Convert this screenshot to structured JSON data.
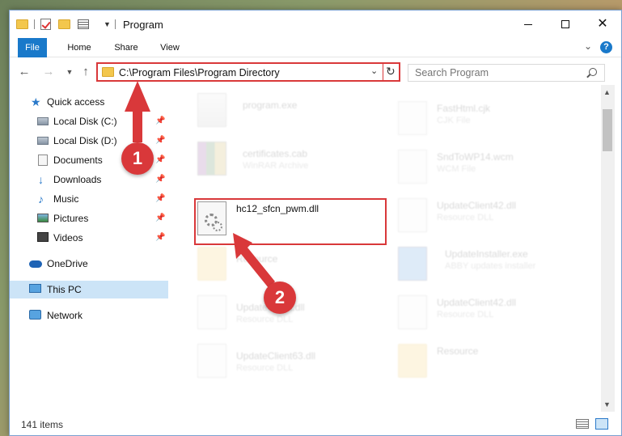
{
  "window": {
    "title": "Program",
    "quick_access_toolbar": [
      "folder-icon",
      "properties-check-icon",
      "new-folder-icon",
      "properties-icon"
    ],
    "controls": {
      "minimize": "minimize-icon",
      "maximize": "maximize-icon",
      "close": "✕"
    }
  },
  "ribbon": {
    "tabs": [
      {
        "label": "File"
      },
      {
        "label": "Home"
      },
      {
        "label": "Share"
      },
      {
        "label": "View"
      }
    ],
    "help": "?"
  },
  "navigation": {
    "address": "C:\\Program Files\\Program Directory",
    "search_placeholder": "Search Program"
  },
  "sidebar": {
    "quick_access": "Quick access",
    "items": [
      {
        "label": "Local Disk (C:)",
        "icon": "disk-icon",
        "pinned": true
      },
      {
        "label": "Local Disk (D:)",
        "icon": "disk-icon",
        "pinned": true
      },
      {
        "label": "Documents",
        "icon": "documents-icon",
        "pinned": true
      },
      {
        "label": "Downloads",
        "icon": "downloads-icon",
        "pinned": true
      },
      {
        "label": "Music",
        "icon": "music-icon",
        "pinned": true
      },
      {
        "label": "Pictures",
        "icon": "pictures-icon",
        "pinned": true
      },
      {
        "label": "Videos",
        "icon": "videos-icon",
        "pinned": true
      }
    ],
    "onedrive": "OneDrive",
    "this_pc": "This PC",
    "network": "Network"
  },
  "files": {
    "left": [
      {
        "name": "program.exe",
        "type": "",
        "icon": "exe-icon"
      },
      {
        "name": "certificates.cab",
        "type": "WinRAR Archive",
        "icon": "winrar-icon"
      },
      {
        "name": "hc12_sfcn_pwm.dll",
        "type": "",
        "icon": "dll-icon"
      },
      {
        "name": "Resource",
        "type": "",
        "icon": "folder-icon"
      },
      {
        "name": "UpdateClient.dll",
        "type": "Resource DLL",
        "icon": "dll-icon"
      },
      {
        "name": "UpdateClient63.dll",
        "type": "Resource DLL",
        "icon": "dll-icon"
      }
    ],
    "right": [
      {
        "name": "FastHtml.cjk",
        "type": "CJK File",
        "icon": "file-icon"
      },
      {
        "name": "SndToWP14.wcm",
        "type": "WCM File",
        "icon": "file-icon"
      },
      {
        "name": "UpdateClient42.dll",
        "type": "Resource DLL",
        "icon": "dll-icon"
      },
      {
        "name": "UpdateInstaller.exe",
        "type": "ABBY updates installer",
        "icon": "installer-icon"
      },
      {
        "name": "UpdateClient42.dll",
        "type": "Resource DLL",
        "icon": "dll-icon"
      },
      {
        "name": "Resource",
        "type": "",
        "icon": "folder-icon"
      }
    ]
  },
  "status": {
    "item_count": "141 items"
  },
  "annotations": {
    "step1": "1",
    "step2": "2",
    "color": "#d9383a"
  }
}
